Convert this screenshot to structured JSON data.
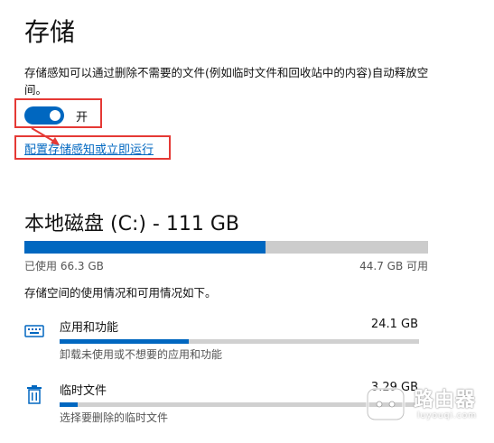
{
  "page": {
    "title": "存储",
    "description": "存储感知可以通过删除不需要的文件(例如临时文件和回收站中的内容)自动释放空间。"
  },
  "storage_sense": {
    "toggle_state": "开",
    "toggle_on": true,
    "configure_link": "配置存储感知或立即运行"
  },
  "disk": {
    "title": "本地磁盘 (C:) - 111 GB",
    "used_label": "已使用 66.3 GB",
    "free_label": "44.7 GB 可用",
    "used_fraction": 0.597,
    "info": "存储空间的使用情况和可用情况如下。"
  },
  "categories": [
    {
      "icon": "keyboard-icon",
      "name": "应用和功能",
      "size": "24.1 GB",
      "fraction": 0.36,
      "description": "卸载未使用或不想要的应用和功能"
    },
    {
      "icon": "trash-icon",
      "name": "临时文件",
      "size": "3.29 GB",
      "fraction": 0.05,
      "description": "选择要删除的临时文件"
    }
  ],
  "watermark": {
    "text": "路由器",
    "subtext": "luyouqi.com"
  },
  "colors": {
    "accent": "#0067c0",
    "highlight_red": "#e53935",
    "track_gray": "#cccccc"
  }
}
